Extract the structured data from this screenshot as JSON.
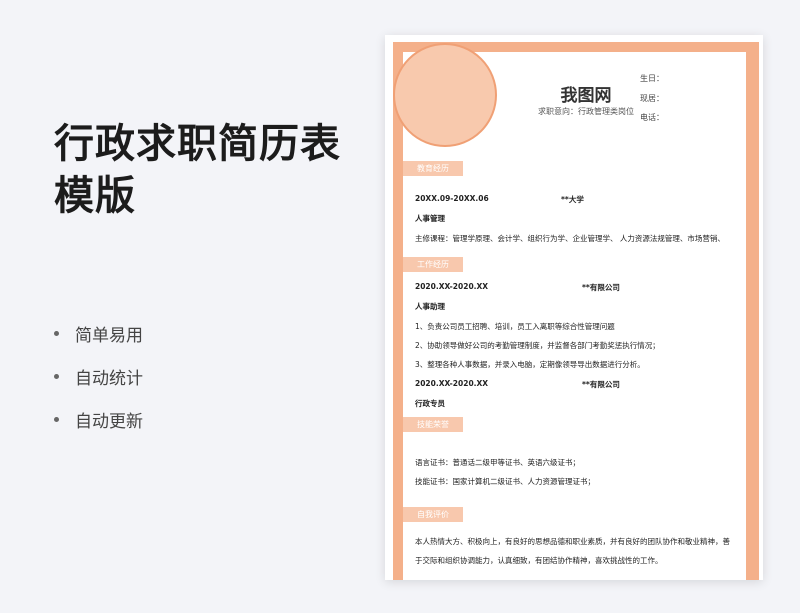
{
  "banner": {
    "title": "行政求职简历表模版",
    "features": [
      "简单易用",
      "自动统计",
      "自动更新"
    ]
  },
  "resume": {
    "name": "我图网",
    "intent": "求职意向：行政管理类岗位",
    "info": [
      "生日：",
      "现居：",
      "电话："
    ],
    "sections": {
      "education": "教育经历",
      "work": "工作经历",
      "skills": "技能荣誉",
      "self": "自我评价"
    },
    "education": {
      "period": "20XX.09-20XX.06",
      "school": "**大学",
      "major": "人事管理",
      "courses": "主修课程：管理学原理、会计学、组织行为学、企业管理学、 人力资源法规管理、市场营销、"
    },
    "work": {
      "job1": {
        "period": "2020.XX-2020.XX",
        "company": "**有限公司",
        "title": "人事助理",
        "duties": [
          "1、负责公司员工招聘、培训，员工入离职等综合性管理问题",
          "2、协助领导做好公司的考勤管理制度，并监督各部门考勤奖惩执行情况；",
          "3、整理各种人事数据，并录入电脑，定期像领导导出数据进行分析。"
        ]
      },
      "job2": {
        "period": "2020.XX-2020.XX",
        "company": "**有限公司",
        "title": "行政专员"
      }
    },
    "skills": [
      "语言证书：普通话二级甲等证书、英语六级证书；",
      "技能证书：国家计算机二级证书、人力资源管理证书；"
    ],
    "self": [
      "本人热情大方、积极向上，有良好的思想品德和职业素质，并有良好的团队协作和敬业精神，善",
      "于交际和组织协调能力，认真细致，有团结协作精神，喜欢挑战性的工作。"
    ]
  }
}
